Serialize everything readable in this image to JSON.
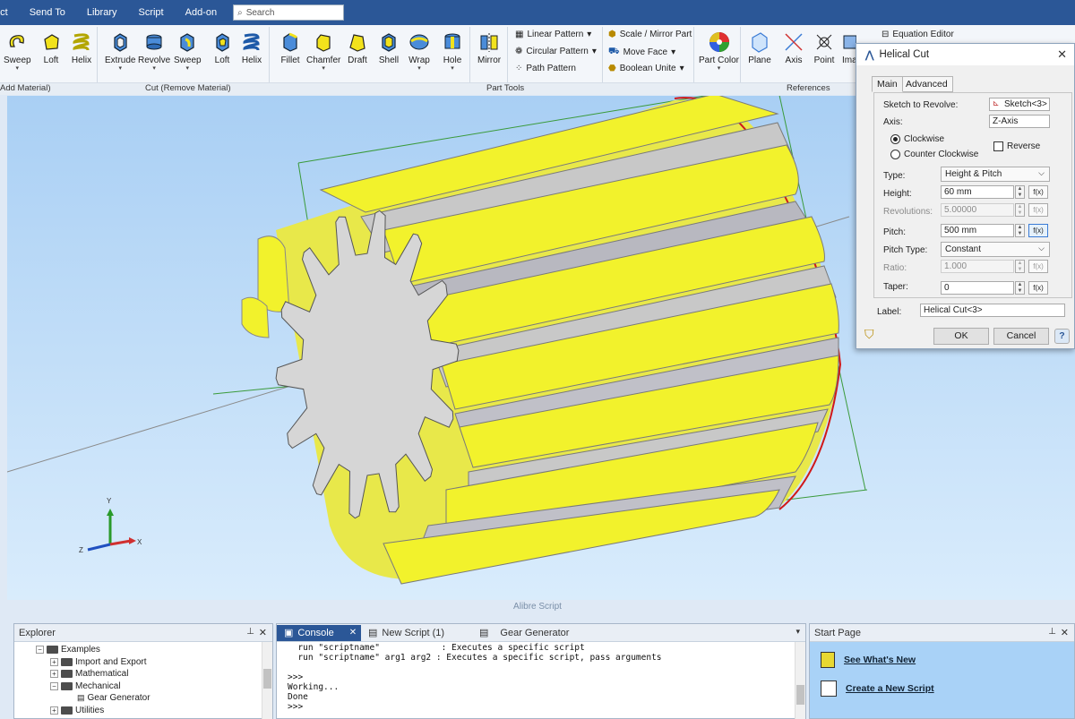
{
  "menu": {
    "items": [
      "ect",
      "Send To",
      "Library",
      "Script",
      "Add-on"
    ],
    "search_placeholder": "Search"
  },
  "ribbon": {
    "add_material": {
      "buttons": [
        "Sweep",
        "Loft",
        "Helix"
      ],
      "label": "Add Material)"
    },
    "cut_material": {
      "buttons": [
        "Extrude",
        "Revolve",
        "Sweep",
        "Loft",
        "Helix"
      ],
      "label": "Cut (Remove Material)"
    },
    "part_tools": {
      "buttons": [
        "Fillet",
        "Chamfer",
        "Draft",
        "Shell",
        "Wrap",
        "Hole",
        "Mirror"
      ],
      "small": [
        "Linear Pattern",
        "Circular Pattern",
        "Path Pattern",
        "Scale / Mirror Part",
        "Move Face",
        "Boolean Unite"
      ],
      "part_color": "Part Color",
      "label": "Part Tools"
    },
    "references": {
      "buttons": [
        "Plane",
        "Axis",
        "Point",
        "Ima"
      ],
      "label": "References"
    },
    "equation_editor": "Equation Editor"
  },
  "viewport": {
    "title": "Alibre Script",
    "axis_labels": {
      "x": "X",
      "y": "Y",
      "z": "Z"
    }
  },
  "dialog": {
    "title": "Helical Cut",
    "tabs": [
      "Main",
      "Advanced"
    ],
    "sketch_label": "Sketch to Revolve:",
    "sketch_value": "Sketch<3>",
    "axis_label": "Axis:",
    "axis_value": "Z-Axis",
    "clockwise": "Clockwise",
    "counter_clockwise": "Counter Clockwise",
    "reverse": "Reverse",
    "type_label": "Type:",
    "type_value": "Height & Pitch",
    "height_label": "Height:",
    "height_value": "60 mm",
    "revolutions_label": "Revolutions:",
    "revolutions_value": "5.00000",
    "pitch_label": "Pitch:",
    "pitch_value": "500 mm",
    "pitch_type_label": "Pitch Type:",
    "pitch_type_value": "Constant",
    "ratio_label": "Ratio:",
    "ratio_value": "1.000",
    "taper_label": "Taper:",
    "taper_value": "0",
    "label_label": "Label:",
    "label_value": "Helical Cut<3>",
    "fx": "f(x)",
    "ok": "OK",
    "cancel": "Cancel",
    "help": "?"
  },
  "explorer": {
    "title": "Explorer",
    "items": [
      "Examples",
      "Import and Export",
      "Mathematical",
      "Mechanical",
      "Gear Generator",
      "Utilities"
    ]
  },
  "console": {
    "tabs": [
      "Console",
      "New Script (1)",
      "Gear Generator"
    ],
    "lines": "  run \"scriptname\"            : Executes a specific script\n  run \"scriptname\" arg1 arg2 : Executes a specific script, pass arguments\n\n>>>\nWorking...\nDone\n>>>"
  },
  "start_page": {
    "title": "Start Page",
    "links": [
      "See What's New",
      "Create a New Script"
    ]
  },
  "colors": {
    "accent": "#2b5797",
    "gear_yellow": "#f2f22c",
    "gear_face": "#d6d6d6",
    "viewport_top": "#a9cff4"
  }
}
